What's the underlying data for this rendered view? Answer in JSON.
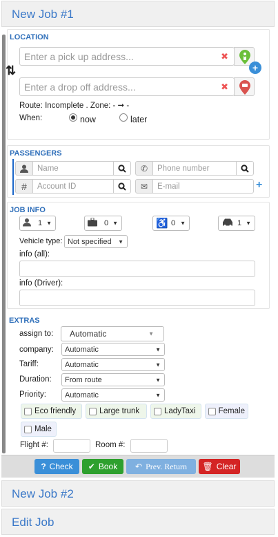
{
  "header": {
    "job1": "New Job #1",
    "job2": "New Job #2",
    "edit": "Edit Job"
  },
  "location": {
    "title": "LOCATION",
    "pickup_placeholder": "Enter a pick up address...",
    "dropoff_placeholder": "Enter a drop off address...",
    "route": "Route: Incomplete . Zone: - ➞ -",
    "when_label": "When:",
    "now": "now",
    "later": "later"
  },
  "passengers": {
    "title": "PASSENGERS",
    "name_placeholder": "Name",
    "phone_placeholder": "Phone number",
    "account_placeholder": "Account ID",
    "email_placeholder": "E-mail"
  },
  "jobinfo": {
    "title": "JOB INFO",
    "passengers_count": "1",
    "luggage_count": "0",
    "wheelchair_count": "0",
    "vehicles_count": "1",
    "vehicle_type_label": "Vehicle type:",
    "vehicle_type_value": "Not specified",
    "info_all_label": "info (all):",
    "info_driver_label": "info (Driver):"
  },
  "extras": {
    "title": "EXTRAS",
    "assign_label": "assign to:",
    "assign_value": "Automatic",
    "company_label": "company:",
    "company_value": "Automatic",
    "tariff_label": "Tariff:",
    "tariff_value": "Automatic",
    "duration_label": "Duration:",
    "duration_value": "From route",
    "priority_label": "Priority:",
    "priority_value": "Automatic",
    "eco": "Eco friendly",
    "trunk": "Large trunk",
    "lady": "LadyTaxi",
    "female": "Female",
    "male": "Male",
    "flight_label": "Flight #:",
    "room_label": "Room #:"
  },
  "actions": {
    "check": "Check",
    "book": "Book",
    "prev": "Prev. Return",
    "clear": "Clear"
  },
  "colors": {
    "accent": "#3a78c8",
    "check": "#3a8fd8",
    "book": "#2ea02e",
    "prev": "#7fb0e0",
    "clear": "#d42424"
  }
}
